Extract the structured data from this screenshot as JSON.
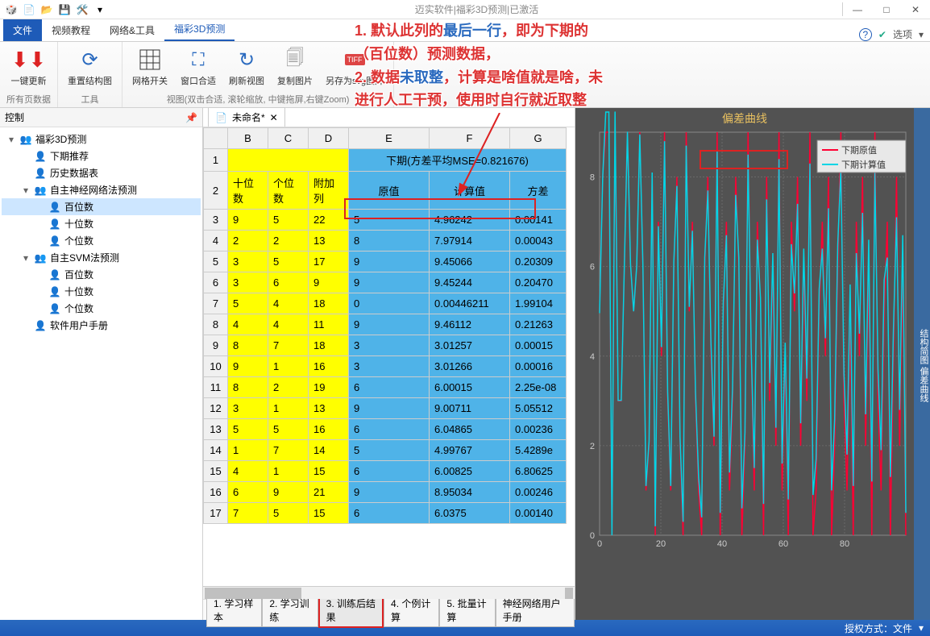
{
  "title": "迈实软件|福彩3D预测|已激活",
  "ribbon_tabs": {
    "file": "文件",
    "t1": "视频教程",
    "t2": "网络&工具",
    "t3": "福彩3D预测"
  },
  "ribbon_right": {
    "help": "?",
    "opts": "选项"
  },
  "toolbar": {
    "update": "一键更新",
    "reset": "重置结构图",
    "grid": "网格开关",
    "fit": "窗口合适",
    "refresh": "刷新视图",
    "copy": "复制图片",
    "svg": "另存为svg图片",
    "g1": "所有页数据",
    "g2": "工具",
    "g3": "视图(双击合适, 滚轮缩放, 中键拖屏,右键Zoom)"
  },
  "panel_title": "控制",
  "tree": [
    {
      "ind": 0,
      "tog": "▾",
      "ic": "people",
      "lbl": "福彩3D预测"
    },
    {
      "ind": 1,
      "ic": "person",
      "lbl": "下期推荐"
    },
    {
      "ind": 1,
      "ic": "person",
      "lbl": "历史数据表"
    },
    {
      "ind": 1,
      "tog": "▾",
      "ic": "people",
      "lbl": "自主神经网络法预测"
    },
    {
      "ind": 2,
      "ic": "person",
      "lbl": "百位数",
      "sel": true
    },
    {
      "ind": 2,
      "ic": "person",
      "lbl": "十位数"
    },
    {
      "ind": 2,
      "ic": "person",
      "lbl": "个位数"
    },
    {
      "ind": 1,
      "tog": "▾",
      "ic": "people",
      "lbl": "自主SVM法预测"
    },
    {
      "ind": 2,
      "ic": "person",
      "lbl": "百位数"
    },
    {
      "ind": 2,
      "ic": "person",
      "lbl": "十位数"
    },
    {
      "ind": 2,
      "ic": "person",
      "lbl": "个位数"
    },
    {
      "ind": 1,
      "ic": "person",
      "lbl": "软件用户手册"
    }
  ],
  "doctab": "未命名*",
  "sheet": {
    "cols": [
      "B",
      "C",
      "D",
      "E",
      "F",
      "G"
    ],
    "mse_header": "下期(方差平均MSE=0.821676)",
    "hdr_yel": [
      "十位数",
      "个位数",
      "附加列"
    ],
    "hdr_blu": [
      "原值",
      "计算值",
      "方差"
    ],
    "rows": [
      {
        "n": 3,
        "y": [
          "9",
          "5",
          "22"
        ],
        "b": [
          "5",
          "4.96242",
          "0.00141"
        ]
      },
      {
        "n": 4,
        "y": [
          "2",
          "2",
          "13"
        ],
        "b": [
          "8",
          "7.97914",
          "0.00043"
        ]
      },
      {
        "n": 5,
        "y": [
          "3",
          "5",
          "17"
        ],
        "b": [
          "9",
          "9.45066",
          "0.20309"
        ]
      },
      {
        "n": 6,
        "y": [
          "3",
          "6",
          "9"
        ],
        "b": [
          "9",
          "9.45244",
          "0.20470"
        ]
      },
      {
        "n": 7,
        "y": [
          "5",
          "4",
          "18"
        ],
        "b": [
          "0",
          "0.00446211",
          "1.99104"
        ]
      },
      {
        "n": 8,
        "y": [
          "4",
          "4",
          "11"
        ],
        "b": [
          "9",
          "9.46112",
          "0.21263"
        ]
      },
      {
        "n": 9,
        "y": [
          "8",
          "7",
          "18"
        ],
        "b": [
          "3",
          "3.01257",
          "0.00015"
        ]
      },
      {
        "n": 10,
        "y": [
          "9",
          "1",
          "16"
        ],
        "b": [
          "3",
          "3.01266",
          "0.00016"
        ]
      },
      {
        "n": 11,
        "y": [
          "8",
          "2",
          "19"
        ],
        "b": [
          "6",
          "6.00015",
          "2.25e-08"
        ]
      },
      {
        "n": 12,
        "y": [
          "3",
          "1",
          "13"
        ],
        "b": [
          "9",
          "9.00711",
          "5.05512"
        ]
      },
      {
        "n": 13,
        "y": [
          "5",
          "5",
          "16"
        ],
        "b": [
          "6",
          "6.04865",
          "0.00236"
        ]
      },
      {
        "n": 14,
        "y": [
          "1",
          "7",
          "14"
        ],
        "b": [
          "5",
          "4.99767",
          "5.4289e"
        ]
      },
      {
        "n": 15,
        "y": [
          "4",
          "1",
          "15"
        ],
        "b": [
          "6",
          "6.00825",
          "6.80625"
        ]
      },
      {
        "n": 16,
        "y": [
          "6",
          "9",
          "21"
        ],
        "b": [
          "9",
          "8.95034",
          "0.00246"
        ]
      },
      {
        "n": 17,
        "y": [
          "7",
          "5",
          "15"
        ],
        "b": [
          "6",
          "6.0375",
          "0.00140"
        ]
      }
    ]
  },
  "bottom_tabs": [
    "1. 学习样本",
    "2. 学习训练",
    "3. 训练后结果",
    "4. 个例计算",
    "5. 批量计算",
    "神经网络用户手册"
  ],
  "chart": {
    "title": "偏差曲线",
    "legend": [
      "下期原值",
      "下期计算值"
    ]
  },
  "chart_data": {
    "type": "line",
    "title": "偏差曲线",
    "xlabel": "",
    "ylabel": "",
    "xlim": [
      0,
      100
    ],
    "ylim": [
      0,
      9
    ],
    "x_ticks": [
      0,
      20,
      40,
      60,
      80
    ],
    "y_ticks": [
      0,
      2,
      4,
      6,
      8
    ],
    "series": [
      {
        "name": "下期原值",
        "color": "#ff0033",
        "values": [
          5,
          8,
          9,
          9,
          0,
          9,
          3,
          3,
          6,
          9,
          6,
          5,
          6,
          9,
          6,
          1,
          2,
          8,
          0,
          7,
          4,
          9,
          3,
          1,
          6,
          8,
          2,
          0,
          9,
          5,
          7,
          3,
          1,
          0,
          6,
          8,
          4,
          2,
          9,
          0,
          5,
          7,
          1,
          3,
          8,
          6,
          0,
          2,
          9,
          4,
          1,
          7,
          5,
          0,
          8,
          3,
          6,
          2,
          9,
          1,
          4,
          0,
          7,
          5,
          8,
          2,
          6,
          3,
          9,
          0,
          1,
          5,
          7,
          4,
          8,
          0,
          2,
          6,
          9,
          3,
          1,
          5,
          0,
          7,
          4,
          8,
          2,
          6,
          0,
          9,
          3,
          1,
          5,
          7,
          0,
          4,
          8,
          2,
          6,
          0
        ]
      },
      {
        "name": "下期计算值",
        "color": "#00d5e5",
        "values": [
          4.96,
          7.98,
          9.45,
          9.45,
          0.0,
          9.46,
          3.01,
          3.01,
          6.0,
          9.01,
          6.05,
          5.0,
          6.01,
          8.95,
          6.04,
          1.1,
          2.1,
          8.1,
          0.2,
          6.9,
          4.2,
          8.8,
          3.2,
          1.1,
          6.1,
          7.8,
          2.2,
          0.3,
          8.7,
          5.1,
          6.8,
          3.2,
          1.3,
          0.4,
          6.2,
          7.7,
          4.3,
          2.2,
          8.6,
          0.5,
          5.2,
          6.7,
          1.4,
          3.3,
          7.6,
          6.2,
          0.6,
          2.3,
          8.5,
          4.2,
          1.5,
          6.6,
          5.3,
          0.7,
          7.5,
          3.4,
          6.3,
          2.4,
          8.4,
          1.6,
          4.3,
          0.8,
          6.5,
          5.4,
          7.4,
          2.5,
          6.4,
          3.5,
          8.3,
          0.9,
          1.7,
          5.5,
          6.4,
          4.4,
          7.3,
          1.0,
          2.6,
          6.5,
          8.2,
          3.6,
          1.8,
          5.6,
          1.1,
          6.3,
          4.5,
          7.2,
          2.7,
          6.6,
          1.2,
          8.1,
          3.7,
          1.9,
          5.7,
          6.2,
          1.3,
          4.6,
          7.1,
          2.8,
          6.7,
          0.5
        ]
      }
    ]
  },
  "status": "授权方式：文件",
  "annot": {
    "l1a": "1. 默认此列的",
    "l1b": "最后一行",
    "l1c": "，即为下期的",
    "l2": "（百位数）预测数据，",
    "l3a": "2. 数据",
    "l3b": "未取整",
    "l3c": "，计算是啥值就是啥，未",
    "l4": "进行人工干预，使用时自行就近取整"
  },
  "right_tabs": "结构简图  偏差曲线"
}
